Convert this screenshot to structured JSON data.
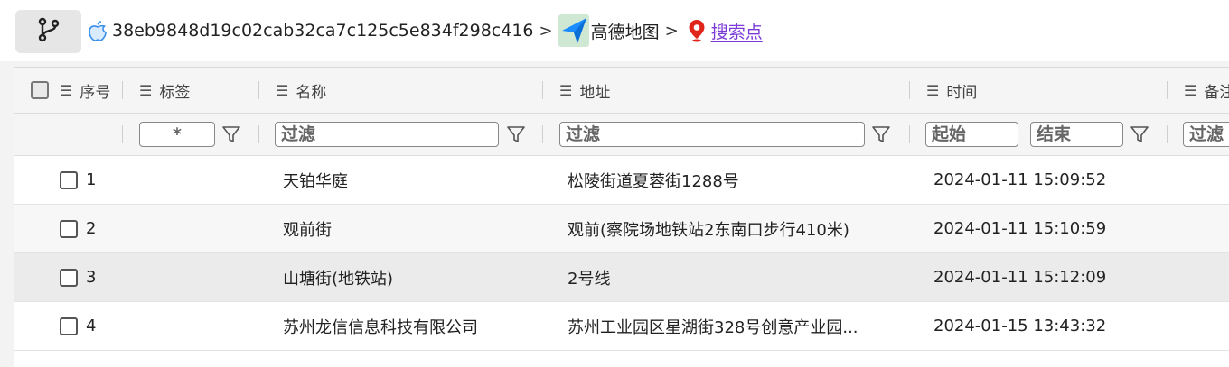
{
  "breadcrumb": {
    "repo_id": "38eb9848d19c02cab32ca7c125c5e834f298c416",
    "app_name": "高德地图",
    "current": "搜索点",
    "separator": ">"
  },
  "icons": {
    "branch": "git-branch-icon",
    "repo": "apple-icon",
    "app": "amap-arrow-icon",
    "current": "location-pin-icon",
    "column": "list-lines-icon",
    "filter": "funnel-icon"
  },
  "colors": {
    "link": "#7a3ad8",
    "pin": "#e0261b",
    "amap": "#1a8cff"
  },
  "table": {
    "columns": [
      "序号",
      "标签",
      "名称",
      "地址",
      "时间",
      "备注"
    ],
    "filters": {
      "tag": "*",
      "name": "过滤",
      "address": "过滤",
      "time_start": "起始",
      "time_end": "结束",
      "note": "过滤"
    },
    "rows": [
      {
        "index": "1",
        "name": "天铂华庭",
        "address": "松陵街道夏蓉街1288号",
        "time": "2024-01-11 15:09:52"
      },
      {
        "index": "2",
        "name": "观前街",
        "address": "观前(察院场地铁站2东南口步行410米)",
        "time": "2024-01-11 15:10:59"
      },
      {
        "index": "3",
        "name": "山塘街(地铁站)",
        "address": "2号线",
        "time": "2024-01-11 15:12:09"
      },
      {
        "index": "4",
        "name": "苏州龙信信息科技有限公司",
        "address": "苏州工业园区星湖街328号创意产业园...",
        "time": "2024-01-15 13:43:32"
      }
    ]
  }
}
